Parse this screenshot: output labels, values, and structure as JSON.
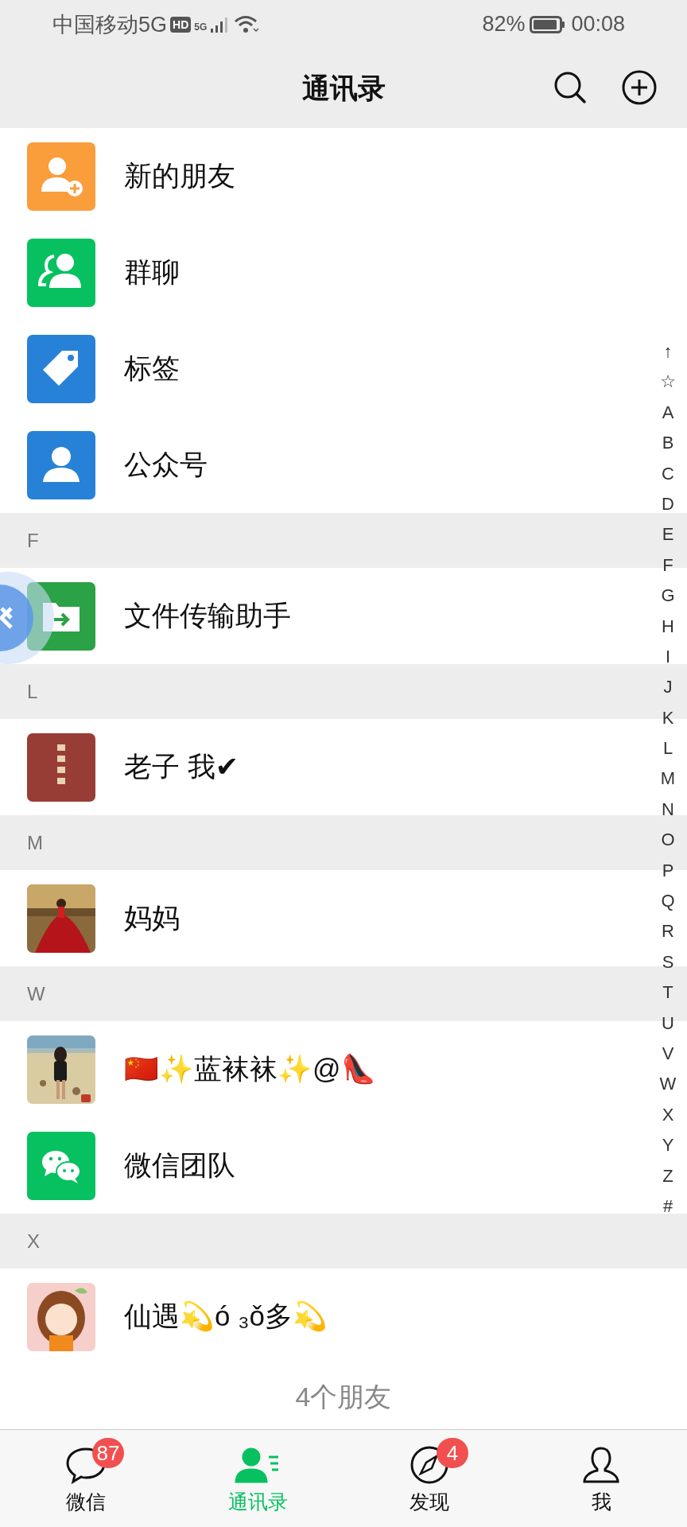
{
  "status_bar": {
    "carrier": "中国移动5G",
    "hd_badge": "HD",
    "network": "5G",
    "battery": "82%",
    "time": "00:08"
  },
  "header": {
    "title": "通讯录"
  },
  "sections": [
    {
      "items": [
        {
          "name": "新的朋友",
          "kind": "new_friends"
        },
        {
          "name": "群聊",
          "kind": "group_chat"
        },
        {
          "name": "标签",
          "kind": "tags"
        },
        {
          "name": "公众号",
          "kind": "official"
        }
      ]
    },
    {
      "letter": "F",
      "items": [
        {
          "name": "文件传输助手",
          "kind": "file_transfer"
        }
      ]
    },
    {
      "letter": "L",
      "items": [
        {
          "name": "老子 我✔",
          "kind": "picture"
        }
      ]
    },
    {
      "letter": "M",
      "items": [
        {
          "name": "妈妈",
          "kind": "picture"
        }
      ]
    },
    {
      "letter": "W",
      "items": [
        {
          "name": "🇨🇳✨蓝袜袜✨@👠",
          "kind": "picture"
        },
        {
          "name": "微信团队",
          "kind": "wechat_team"
        }
      ]
    },
    {
      "letter": "X",
      "items": [
        {
          "name": "仙遇💫ó ₃ǒ多💫",
          "kind": "picture"
        }
      ]
    }
  ],
  "index": [
    "↑",
    "☆",
    "A",
    "B",
    "C",
    "D",
    "E",
    "F",
    "G",
    "H",
    "I",
    "J",
    "K",
    "L",
    "M",
    "N",
    "O",
    "P",
    "Q",
    "R",
    "S",
    "T",
    "U",
    "V",
    "W",
    "X",
    "Y",
    "Z",
    "#"
  ],
  "footer": "4个朋友",
  "tabs": [
    {
      "label": "微信",
      "kind": "chats",
      "badge": "87",
      "selected": false
    },
    {
      "label": "通讯录",
      "kind": "contacts",
      "selected": true
    },
    {
      "label": "发现",
      "kind": "discover",
      "badge": "4",
      "selected": false
    },
    {
      "label": "我",
      "kind": "me",
      "selected": false
    }
  ]
}
